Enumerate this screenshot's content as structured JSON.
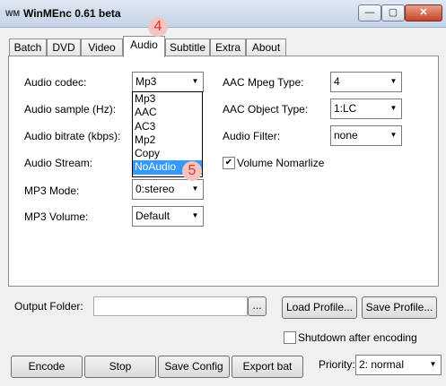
{
  "window": {
    "title": "WinMEnc 0.61 beta",
    "icon_text": "WM"
  },
  "tabs": [
    "Batch",
    "DVD",
    "Video",
    "Audio",
    "Subtitle",
    "Extra",
    "About"
  ],
  "annotations": {
    "tab_marker": "4",
    "option_marker": "5"
  },
  "audio": {
    "codec_label": "Audio codec:",
    "codec_value": "Mp3",
    "codec_options": [
      "Mp3",
      "AAC",
      "AC3",
      "Mp2",
      "Copy",
      "NoAudio"
    ],
    "sample_label": "Audio sample (Hz):",
    "bitrate_label": "Audio bitrate (kbps):",
    "stream_label": "Audio Stream:",
    "mp3mode_label": "MP3 Mode:",
    "mp3mode_value": "0:stereo",
    "mp3volume_label": "MP3 Volume:",
    "mp3volume_value": "Default",
    "aac_mpeg_label": "AAC Mpeg Type:",
    "aac_mpeg_value": "4",
    "aac_object_label": "AAC Object Type:",
    "aac_object_value": "1:LC",
    "filter_label": "Audio Filter:",
    "filter_value": "none",
    "normalize_label": "Volume Nomarlize",
    "normalize_checked": "✔"
  },
  "bottom": {
    "output_label": "Output Folder:",
    "output_value": "",
    "browse_label": "...",
    "load_profile": "Load Profile...",
    "save_profile": "Save Profile...",
    "shutdown_label": "Shutdown after encoding",
    "encode": "Encode",
    "stop": "Stop",
    "save_config": "Save Config",
    "export_bat": "Export bat",
    "priority_label": "Priority:",
    "priority_value": "2: normal"
  }
}
